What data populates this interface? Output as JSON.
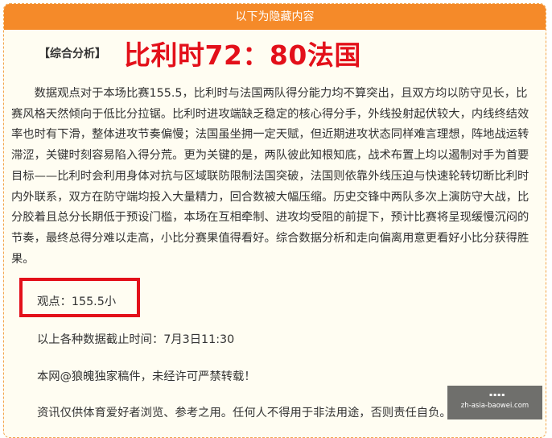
{
  "header": {
    "hidden_label": "以下为隐藏内容"
  },
  "title": {
    "tag": "【综合分析】",
    "headline": "比利时72：80法国"
  },
  "analysis": "数据观点对于本场比赛155.5，比利时与法国两队得分能力均不算突出，且双方均以防守见长，比赛风格天然倾向于低比分拉锯。比利时进攻端缺乏稳定的核心得分手，外线投射起伏较大，内线终结效率也时有下滑，整体进攻节奏偏慢；法国虽坐拥一定天赋，但近期进攻状态同样难言理想，阵地战运转滞涩，关键时刻容易陷入得分荒。更为关键的是，两队彼此知根知底，战术布置上均以遏制对手为首要目标——比利时会利用身体对抗与区域联防限制法国突破，法国则依靠外线压迫与快速轮转切断比利时内外联系，双方在防守端均投入大量精力，回合数被大幅压缩。历史交锋中两队多次上演防守大战，比分胶着且总分长期低于预设门槛，本场在互相牵制、进攻均受阻的前提下，预计比赛将呈现缓慢沉闷的节奏，最终总得分难以走高，小比分赛果值得看好。综合数据分析和走向偏离用意更看好小比分获得胜果。",
  "viewpoint": "观点：155.5小",
  "cutoff_time": "以上各种数据截止时间：7月3日11:30",
  "copyright": "本网@狼魄独家稿件，未经许可严禁转载！",
  "disclaimer": "资讯仅供体育爱好者浏览、参考之用。任何人不得用于非法用途，否则责任自负。",
  "watermark": {
    "icon": "▪▪▪▪",
    "url": "zh-asia-baowei.com"
  },
  "colors": {
    "header_bg": "#f58a29",
    "headline": "#e3101a",
    "highlight_border": "#e3101a",
    "panel_bg": "#fffdf2"
  }
}
